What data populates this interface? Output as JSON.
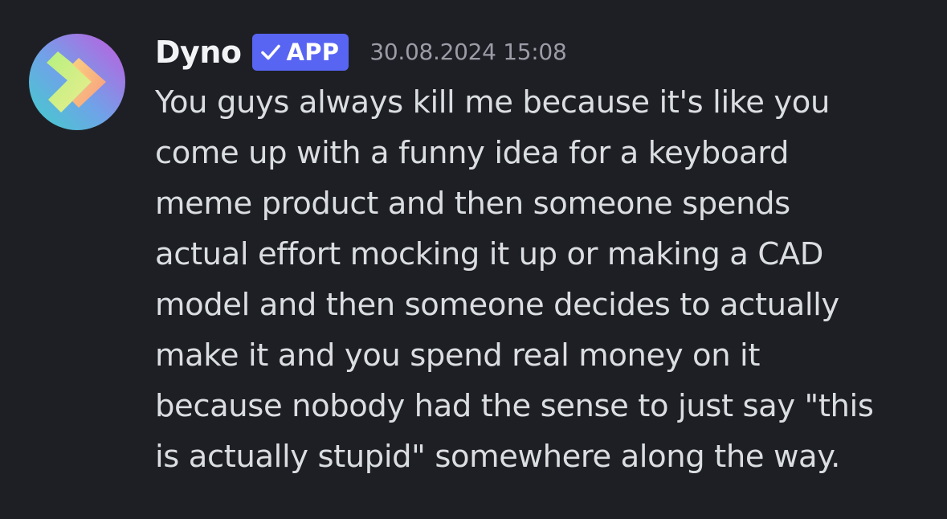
{
  "message": {
    "author": {
      "name": "Dyno",
      "badge_label": "APP",
      "avatar_icon": "dyno-logo-icon",
      "badge_icon": "verified-check-icon",
      "badge_color": "#5865f2"
    },
    "timestamp": "30.08.2024 15:08",
    "lines": [
      "You guys always kill me because it's like you",
      "come up with a funny idea for a keyboard",
      "meme product and then someone spends",
      "actual effort mocking it up or making a CAD",
      "model and then someone decides to actually",
      "make it and you spend real money on it",
      "because nobody had the sense to just say \"this",
      "is actually stupid\" somewhere along the way."
    ]
  },
  "colors": {
    "background": "#1e1f25",
    "username": "#f2f3f5",
    "text": "#dbdee1",
    "timestamp": "#9b9ca6"
  }
}
